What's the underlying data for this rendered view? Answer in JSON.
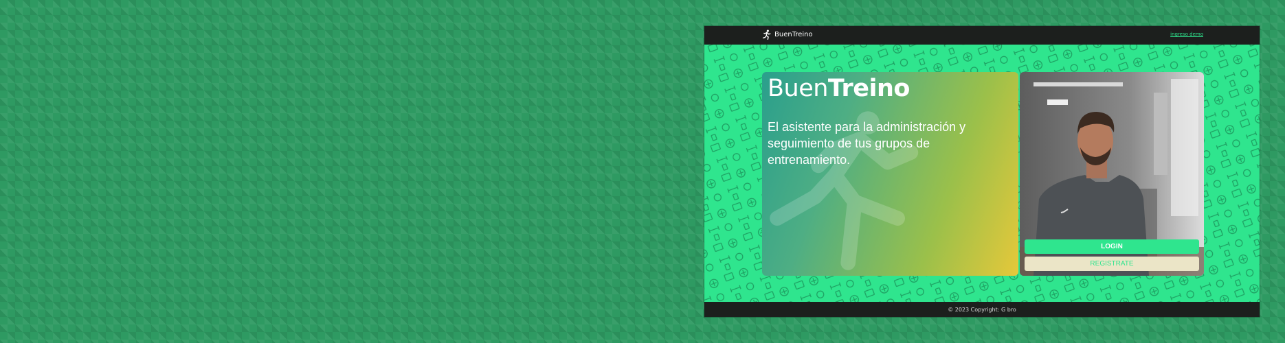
{
  "navbar": {
    "brand": "BuenTreino",
    "demo_link": "ingreso demo"
  },
  "hero": {
    "title_light": "Buen",
    "title_bold": "Treino",
    "subtitle": "El asistente para la administración y seguimiento de tus grupos de entrenamiento."
  },
  "auth": {
    "login_label": "LOGIN",
    "register_label": "REGISTRATE"
  },
  "footer": {
    "copyright": "© 2023 Copyright: G bro"
  },
  "colors": {
    "accent": "#2fe58e",
    "dark": "#1c1f1d",
    "gradient_start": "#2a9f8c",
    "gradient_end": "#e6c83a",
    "register_bg": "#ebe5c7"
  }
}
